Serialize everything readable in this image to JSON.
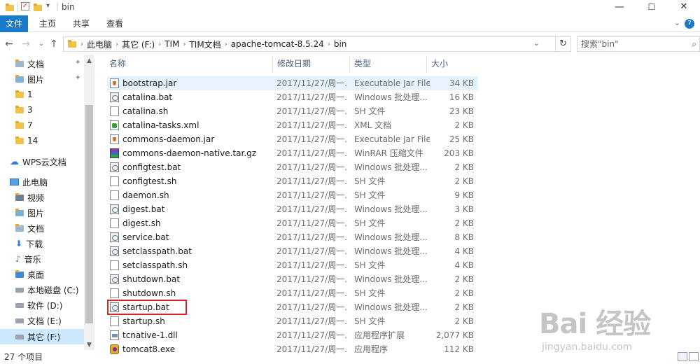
{
  "window": {
    "title": "bin",
    "min": "—",
    "max": "☐",
    "close": "✕"
  },
  "ribbon": {
    "tabs": [
      "文件",
      "主页",
      "共享",
      "查看"
    ],
    "help": "?"
  },
  "address": {
    "crumbs": [
      "此电脑",
      "其它 (F:)",
      "TIM",
      "TIM文档",
      "apache-tomcat-8.5.24",
      "bin"
    ],
    "search_placeholder": "搜索\"bin\""
  },
  "nav": {
    "items": [
      {
        "label": "文档",
        "icon": "documents-icon",
        "pinned": true
      },
      {
        "label": "图片",
        "icon": "pictures-icon",
        "pinned": true
      },
      {
        "label": "1",
        "icon": "folder-icon"
      },
      {
        "label": "3",
        "icon": "folder-icon"
      },
      {
        "label": "7",
        "icon": "folder-icon"
      },
      {
        "label": "14",
        "icon": "folder-icon"
      },
      {
        "label": "WPS云文档",
        "icon": "cloud-icon"
      },
      {
        "label": "此电脑",
        "icon": "computer-icon"
      },
      {
        "label": "视频",
        "icon": "videos-icon"
      },
      {
        "label": "图片",
        "icon": "pictures-icon"
      },
      {
        "label": "文档",
        "icon": "documents-icon"
      },
      {
        "label": "下载",
        "icon": "downloads-icon"
      },
      {
        "label": "音乐",
        "icon": "music-icon"
      },
      {
        "label": "桌面",
        "icon": "desktop-icon"
      },
      {
        "label": "本地磁盘 (C:)",
        "icon": "drive-icon"
      },
      {
        "label": "软件 (D:)",
        "icon": "drive-icon"
      },
      {
        "label": "文档 (E:)",
        "icon": "drive-icon"
      },
      {
        "label": "其它 (F:)",
        "icon": "drive-icon",
        "selected": true
      }
    ]
  },
  "columns": {
    "name": "名称",
    "date": "修改日期",
    "type": "类型",
    "size": "大小"
  },
  "files": [
    {
      "name": "bootstrap.jar",
      "date": "2017/11/27/周一...",
      "type": "Executable Jar File",
      "size": "34 KB",
      "icon": "jar"
    },
    {
      "name": "catalina.bat",
      "date": "2017/11/27/周一...",
      "type": "Windows 批处理...",
      "size": "16 KB",
      "icon": "bat"
    },
    {
      "name": "catalina.sh",
      "date": "2017/11/27/周一...",
      "type": "SH 文件",
      "size": "23 KB",
      "icon": "doc"
    },
    {
      "name": "catalina-tasks.xml",
      "date": "2017/11/27/周一...",
      "type": "XML 文档",
      "size": "2 KB",
      "icon": "xml"
    },
    {
      "name": "commons-daemon.jar",
      "date": "2017/11/27/周一...",
      "type": "Executable Jar File",
      "size": "25 KB",
      "icon": "jar"
    },
    {
      "name": "commons-daemon-native.tar.gz",
      "date": "2017/11/27/周一...",
      "type": "WinRAR 压缩文件",
      "size": "203 KB",
      "icon": "rar"
    },
    {
      "name": "configtest.bat",
      "date": "2017/11/27/周一...",
      "type": "Windows 批处理...",
      "size": "2 KB",
      "icon": "bat"
    },
    {
      "name": "configtest.sh",
      "date": "2017/11/27/周一...",
      "type": "SH 文件",
      "size": "2 KB",
      "icon": "doc"
    },
    {
      "name": "daemon.sh",
      "date": "2017/11/27/周一...",
      "type": "SH 文件",
      "size": "9 KB",
      "icon": "doc"
    },
    {
      "name": "digest.bat",
      "date": "2017/11/27/周一...",
      "type": "Windows 批处理...",
      "size": "3 KB",
      "icon": "bat"
    },
    {
      "name": "digest.sh",
      "date": "2017/11/27/周一...",
      "type": "SH 文件",
      "size": "2 KB",
      "icon": "doc"
    },
    {
      "name": "service.bat",
      "date": "2017/11/27/周一...",
      "type": "Windows 批处理...",
      "size": "8 KB",
      "icon": "bat"
    },
    {
      "name": "setclasspath.bat",
      "date": "2017/11/27/周一...",
      "type": "Windows 批处理...",
      "size": "4 KB",
      "icon": "bat"
    },
    {
      "name": "setclasspath.sh",
      "date": "2017/11/27/周一...",
      "type": "SH 文件",
      "size": "4 KB",
      "icon": "doc"
    },
    {
      "name": "shutdown.bat",
      "date": "2017/11/27/周一...",
      "type": "Windows 批处理...",
      "size": "2 KB",
      "icon": "bat"
    },
    {
      "name": "shutdown.sh",
      "date": "2017/11/27/周一...",
      "type": "SH 文件",
      "size": "2 KB",
      "icon": "doc"
    },
    {
      "name": "startup.bat",
      "date": "2017/11/27/周一...",
      "type": "Windows 批处理...",
      "size": "2 KB",
      "icon": "bat"
    },
    {
      "name": "startup.sh",
      "date": "2017/11/27/周一...",
      "type": "SH 文件",
      "size": "2 KB",
      "icon": "doc"
    },
    {
      "name": "tcnative-1.dll",
      "date": "2017/11/27/周一...",
      "type": "应用程序扩展",
      "size": "2,077 KB",
      "icon": "dll"
    },
    {
      "name": "tomcat8.exe",
      "date": "2017/11/27/周一...",
      "type": "应用程序",
      "size": "112 KB",
      "icon": "exe"
    }
  ],
  "status": {
    "count": "27 个项目"
  },
  "watermark": {
    "top": "Bai 经验",
    "bottom": "jingyan.baidu.com"
  }
}
